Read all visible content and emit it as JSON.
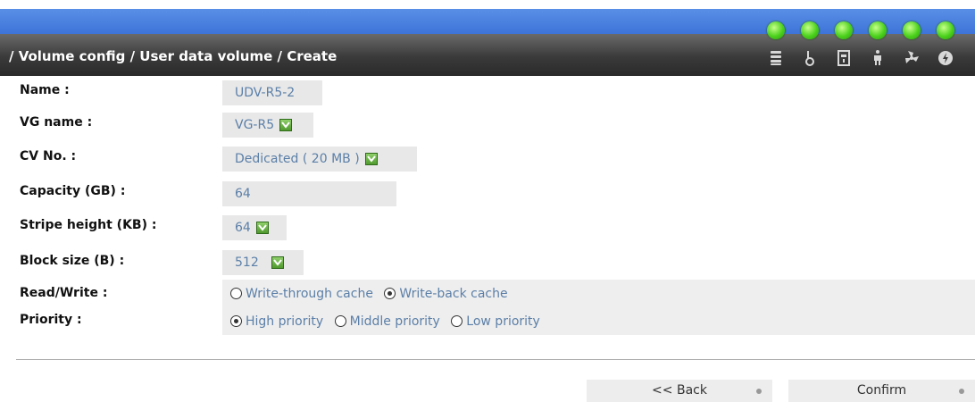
{
  "header": {
    "breadcrumb": "/ Volume config / User data volume / Create",
    "status_leds": [
      "led",
      "led",
      "led",
      "led",
      "led",
      "led"
    ],
    "status_icons": [
      "disk-icon",
      "temperature-icon",
      "memory-icon",
      "voltage-icon",
      "fan-icon",
      "power-icon"
    ]
  },
  "form": {
    "name": {
      "label": "Name :",
      "value": "UDV-R5-2"
    },
    "vg_name": {
      "label": "VG name :",
      "value": "VG-R5"
    },
    "cv_no": {
      "label": "CV No. :",
      "value": "Dedicated ( 20 MB )"
    },
    "capacity": {
      "label": "Capacity (GB) :",
      "value": "64"
    },
    "stripe_height": {
      "label": "Stripe height (KB) :",
      "value": "64"
    },
    "block_size": {
      "label": "Block size (B) :",
      "value": "512"
    },
    "read_write": {
      "label": "Read/Write :",
      "options": [
        "Write-through cache",
        "Write-back cache"
      ],
      "selected": "Write-back cache"
    },
    "priority": {
      "label": "Priority :",
      "options": [
        "High priority",
        "Middle priority",
        "Low priority"
      ],
      "selected": "High priority"
    }
  },
  "buttons": {
    "back": "<< Back",
    "confirm": "Confirm"
  },
  "colors": {
    "led": "#4bd11c",
    "field_text": "#5b7fa8",
    "header_blue": "#3e74d8"
  }
}
